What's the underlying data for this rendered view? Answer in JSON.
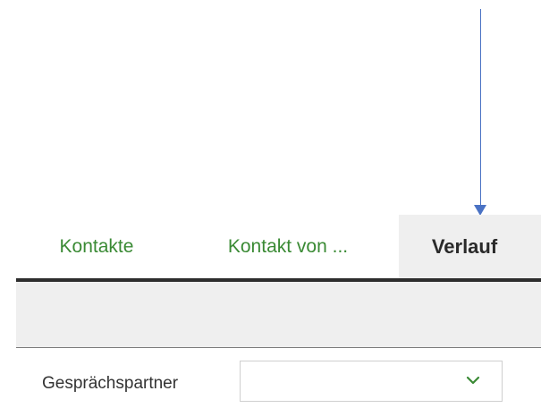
{
  "tabs": [
    {
      "label": "Kontakte",
      "active": false
    },
    {
      "label": "Kontakt von ...",
      "active": true
    },
    {
      "label": "Verlauf",
      "active": true
    }
  ],
  "form": {
    "gespraechspartner_label": "Gesprächspartner",
    "gespraechspartner_value": ""
  },
  "icons": {
    "annotation_arrow": "arrow-down-icon",
    "select_chevron": "chevron-down-icon"
  },
  "colors": {
    "tab_text": "#3a8a34",
    "active_tab_bg": "#efefef",
    "active_tab_text": "#2a2a2a",
    "underline": "#2d2d2d",
    "arrow": "#4a72c4",
    "chevron": "#3a8a34"
  }
}
